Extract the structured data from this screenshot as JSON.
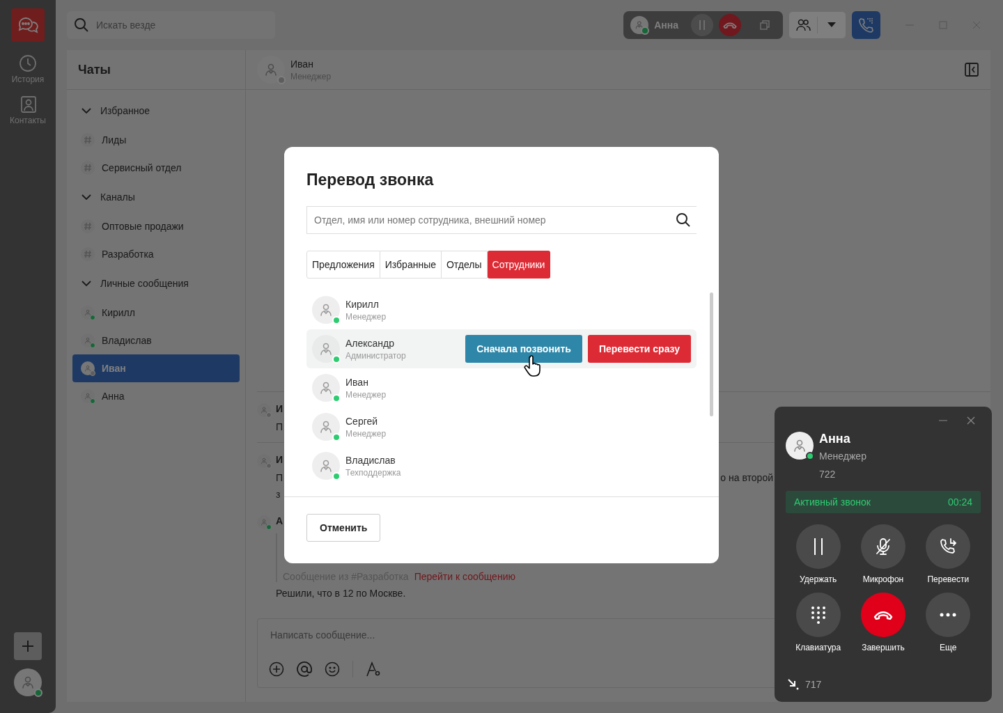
{
  "rail": {
    "items": [
      {
        "label": "История",
        "kind": "history",
        "selected": false
      },
      {
        "label": "Контакты",
        "kind": "contacts",
        "selected": false
      }
    ],
    "user": {
      "online": true
    }
  },
  "search": {
    "placeholder": "Искать везде"
  },
  "call_bar": {
    "name": "Анна",
    "online": true
  },
  "chats": {
    "title": "Чаты",
    "sections": [
      {
        "label": "Избранное",
        "expanded": true,
        "children": [
          {
            "label": "Лиды",
            "kind": "channel",
            "selected": false
          },
          {
            "label": "Сервисный отдел",
            "kind": "channel",
            "selected": false
          }
        ]
      },
      {
        "label": "Каналы",
        "expanded": true,
        "children": [
          {
            "label": "Оптовые продажи",
            "kind": "channel",
            "selected": false
          },
          {
            "label": "Разработка",
            "kind": "channel",
            "selected": false
          }
        ]
      },
      {
        "label": "Личные сообщения",
        "expanded": true,
        "children": [
          {
            "label": "Кирилл",
            "kind": "person",
            "online": true,
            "selected": false
          },
          {
            "label": "Владислав",
            "kind": "person",
            "online": true,
            "selected": false
          },
          {
            "label": "Иван",
            "kind": "person",
            "online": false,
            "selected": true
          },
          {
            "label": "Анна",
            "kind": "person",
            "online": true,
            "selected": false
          }
        ]
      }
    ]
  },
  "chat": {
    "name": "Иван",
    "role": "Менеджер",
    "online": false,
    "messages": [
      {
        "author": "И",
        "online": false,
        "lines": [
          {
            "text": "П"
          }
        ]
      },
      {
        "author": "И",
        "online": false,
        "lines": [
          {
            "text": "П",
            "tail": "о на второй"
          },
          {
            "text": "з"
          }
        ]
      },
      {
        "author": "А",
        "online": true,
        "quote": {
          "source": "Сообщение из #Разработка",
          "link": "Перейти к сообщению"
        },
        "lines": [
          {
            "text": "Решили, что в 12 по Москве."
          }
        ]
      }
    ],
    "composer": {
      "placeholder": "Написать сообщение..."
    }
  },
  "transfer_dialog": {
    "title": "Перевод звонка",
    "search": {
      "placeholder": "Отдел, имя или номер сотрудника, внешний номер"
    },
    "tabs": [
      {
        "label": "Предложения",
        "selected": false
      },
      {
        "label": "Избранные",
        "selected": false
      },
      {
        "label": "Отделы",
        "selected": false
      },
      {
        "label": "Сотрудники",
        "selected": true
      }
    ],
    "employees": [
      {
        "name": "Кирилл",
        "role": "Менеджер",
        "online": true,
        "hovered": false
      },
      {
        "name": "Александр",
        "role": "Администратор",
        "online": true,
        "hovered": true
      },
      {
        "name": "Иван",
        "role": "Менеджер",
        "online": true,
        "hovered": false
      },
      {
        "name": "Сергей",
        "role": "Менеджер",
        "online": true,
        "hovered": false
      },
      {
        "name": "Владислав",
        "role": "Техподдержка",
        "online": true,
        "hovered": false
      }
    ],
    "row_actions": [
      {
        "label": "Сначала позвонить",
        "kind": "primary"
      },
      {
        "label": "Перевести сразу",
        "kind": "danger"
      }
    ],
    "cancel": "Отменить"
  },
  "call_panel": {
    "name": "Анна",
    "role": "Менеджер",
    "number": "722",
    "online": true,
    "status": "Активный звонок",
    "duration": "00:24",
    "controls": [
      {
        "label": "Удержать",
        "kind": "hold"
      },
      {
        "label": "Микрофон",
        "kind": "mic"
      },
      {
        "label": "Перевести",
        "kind": "transfer"
      },
      {
        "label": "Клавиатура",
        "kind": "keypad"
      },
      {
        "label": "Завершить",
        "kind": "hangup"
      },
      {
        "label": "Еще",
        "kind": "more"
      }
    ],
    "incoming": {
      "number": "717"
    }
  }
}
